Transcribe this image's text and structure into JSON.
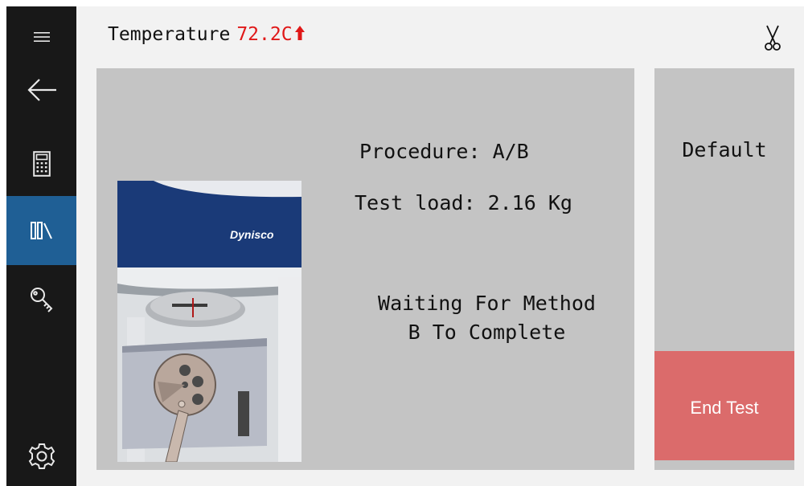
{
  "header": {
    "title": "Temperature",
    "temperature": "72.2C",
    "temperature_color": "#e01818",
    "trend_icon": "temperature-rising-arrow-icon",
    "tool_icon": "scissors-icon"
  },
  "sidebar": {
    "items": [
      {
        "name": "menu",
        "icon": "hamburger-menu-icon"
      },
      {
        "name": "back",
        "icon": "back-arrow-icon"
      },
      {
        "name": "calculator",
        "icon": "calculator-icon"
      },
      {
        "name": "library",
        "icon": "library-icon",
        "active": true
      },
      {
        "name": "key",
        "icon": "key-icon"
      },
      {
        "name": "settings",
        "icon": "gear-icon"
      }
    ],
    "active_color": "#1f5f95"
  },
  "main": {
    "procedure": "Procedure: A/B",
    "test_load": "Test load: 2.16 Kg",
    "status_line1": "Waiting For Method",
    "status_line2": "B To Complete",
    "image_brand": "Dynisco"
  },
  "side": {
    "default_label": "Default",
    "end_test_label": "End Test",
    "end_test_color": "#db6b6b"
  }
}
